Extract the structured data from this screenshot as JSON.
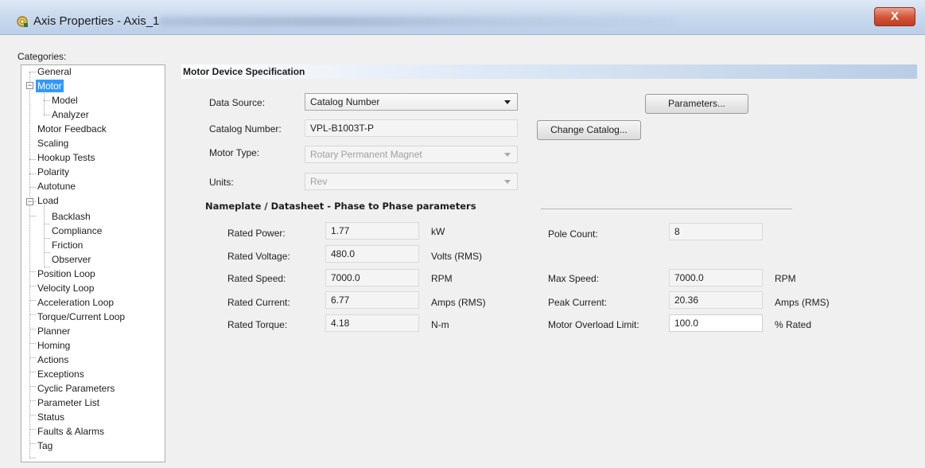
{
  "window": {
    "title": "Axis Properties - Axis_1",
    "close_label": "X"
  },
  "categories": {
    "label": "Categories:",
    "items": [
      {
        "label": "General"
      },
      {
        "label": "Motor"
      },
      {
        "label": "Model"
      },
      {
        "label": "Analyzer"
      },
      {
        "label": "Motor Feedback"
      },
      {
        "label": "Scaling"
      },
      {
        "label": "Hookup Tests"
      },
      {
        "label": "Polarity"
      },
      {
        "label": "Autotune"
      },
      {
        "label": "Load"
      },
      {
        "label": "Backlash"
      },
      {
        "label": "Compliance"
      },
      {
        "label": "Friction"
      },
      {
        "label": "Observer"
      },
      {
        "label": "Position Loop"
      },
      {
        "label": "Velocity Loop"
      },
      {
        "label": "Acceleration Loop"
      },
      {
        "label": "Torque/Current Loop"
      },
      {
        "label": "Planner"
      },
      {
        "label": "Homing"
      },
      {
        "label": "Actions"
      },
      {
        "label": "Exceptions"
      },
      {
        "label": "Cyclic Parameters"
      },
      {
        "label": "Parameter List"
      },
      {
        "label": "Status"
      },
      {
        "label": "Faults & Alarms"
      },
      {
        "label": "Tag"
      }
    ],
    "selected": "Motor"
  },
  "motor_spec": {
    "section_title": "Motor Device Specification",
    "data_source_label": "Data Source:",
    "data_source_value": "Catalog Number",
    "catalog_number_label": "Catalog Number:",
    "catalog_number_value": "VPL-B1003T-P",
    "motor_type_label": "Motor Type:",
    "motor_type_value": "Rotary Permanent Magnet",
    "units_label": "Units:",
    "units_value": "Rev",
    "parameters_button": "Parameters...",
    "change_catalog_button": "Change Catalog..."
  },
  "nameplate": {
    "title": "Nameplate / Datasheet - Phase to Phase parameters",
    "rated_power": {
      "label": "Rated Power:",
      "value": "1.77",
      "unit": "kW"
    },
    "rated_voltage": {
      "label": "Rated Voltage:",
      "value": "480.0",
      "unit": "Volts (RMS)"
    },
    "rated_speed": {
      "label": "Rated Speed:",
      "value": "7000.0",
      "unit": "RPM"
    },
    "rated_current": {
      "label": "Rated Current:",
      "value": "6.77",
      "unit": "Amps (RMS)"
    },
    "rated_torque": {
      "label": "Rated Torque:",
      "value": "4.18",
      "unit": "N-m"
    },
    "pole_count": {
      "label": "Pole Count:",
      "value": "8"
    },
    "max_speed": {
      "label": "Max Speed:",
      "value": "7000.0",
      "unit": "RPM"
    },
    "peak_current": {
      "label": "Peak Current:",
      "value": "20.36",
      "unit": "Amps (RMS)"
    },
    "motor_overload_limit": {
      "label": "Motor Overload Limit:",
      "value": "100.0",
      "unit": "% Rated"
    }
  },
  "colors": {
    "selection": "#3399ff",
    "titlebar": "#c9daef",
    "close": "#d5583a"
  }
}
